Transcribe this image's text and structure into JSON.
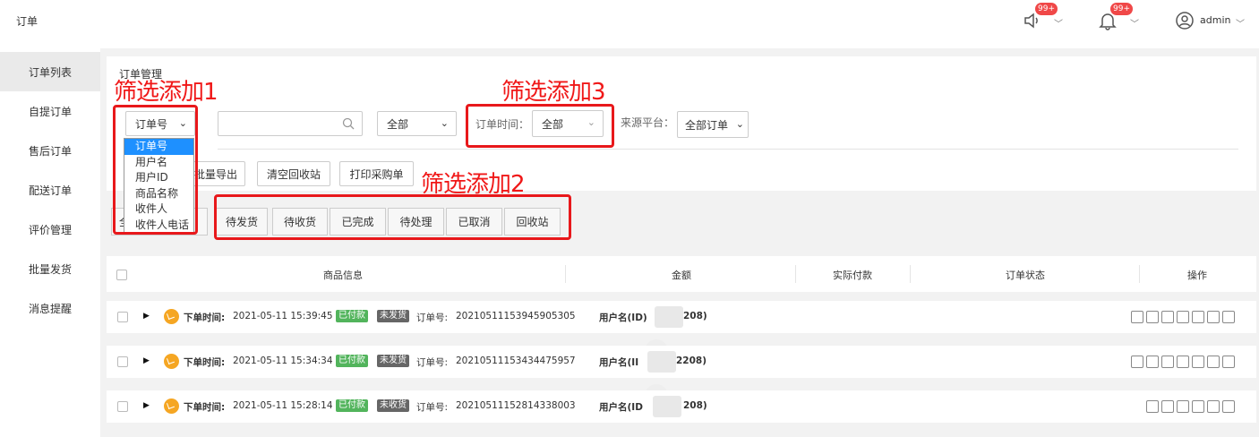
{
  "header": {
    "title": "订单",
    "notice_badge": "99+",
    "bell_badge": "99+",
    "user": "admin"
  },
  "sidebar": {
    "items": [
      {
        "label": "订单列表"
      },
      {
        "label": "自提订单"
      },
      {
        "label": "售后订单"
      },
      {
        "label": "配送订单"
      },
      {
        "label": "评价管理"
      },
      {
        "label": "批量发货"
      },
      {
        "label": "消息提醒"
      }
    ]
  },
  "panel": {
    "title": "订单管理"
  },
  "annotations": {
    "a1": "筛选添加1",
    "a2": "筛选添加2",
    "a3": "筛选添加3"
  },
  "filters": {
    "search_type": "订单号",
    "search_type_options": [
      "订单号",
      "用户名",
      "用户ID",
      "商品名称",
      "收件人",
      "收件人电话"
    ],
    "search_value": "",
    "status_select": "全部",
    "order_time_label": "订单时间：",
    "order_time_value": "全部",
    "platform_label": "来源平台：",
    "platform_value": "全部订单"
  },
  "actions": {
    "batch_export": "批量导出",
    "clear_recycle": "清空回收站",
    "print_purchase": "打印采购单"
  },
  "tabs": [
    "全",
    "待发货",
    "待收货",
    "已完成",
    "待处理",
    "已取消",
    "回收站"
  ],
  "table": {
    "headers": [
      "商品信息",
      "金额",
      "实际付款",
      "订单状态",
      "操作"
    ],
    "rows": [
      {
        "time_label": "下单时间:",
        "time": "2021-05-11 15:39:45",
        "paid": "已付款",
        "ship": "未发货",
        "order_label": "订单号:",
        "order_no": "20210511153945905305",
        "user_prefix": "用户名(ID)",
        "user_suffix": "208)"
      },
      {
        "time_label": "下单时间:",
        "time": "2021-05-11 15:34:34",
        "paid": "已付款",
        "ship": "未发货",
        "order_label": "订单号:",
        "order_no": "20210511153434475957",
        "user_prefix": "用户名(II",
        "user_suffix": "2208)"
      },
      {
        "time_label": "下单时间:",
        "time": "2021-05-11 15:28:14",
        "paid": "已付款",
        "ship": "未收货",
        "order_label": "订单号:",
        "order_no": "20210511152814338003",
        "user_prefix": "用户名(ID",
        "user_suffix": "208)"
      }
    ]
  },
  "colors": {
    "annotation_red": "#e8181b",
    "badge_red": "#f04848",
    "paid_green": "#52b45c",
    "ship_grey": "#666666",
    "clock_orange": "#f5a623"
  }
}
